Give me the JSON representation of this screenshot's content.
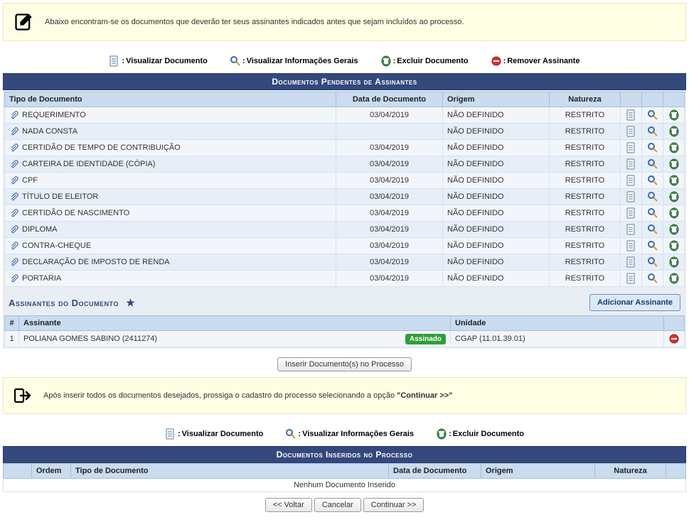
{
  "info1": "Abaixo encontram-se os documentos que deverão ter seus assinantes indicados antes que sejam incluídos ao processo.",
  "legend": {
    "view_doc": "Visualizar Documento",
    "view_info": "Visualizar Informações Gerais",
    "delete_doc": "Excluir Documento",
    "remove_signer": "Remover Assinante"
  },
  "section1_title": "Documentos Pendentes de Assinantes",
  "table1_headers": {
    "tipo": "Tipo de Documento",
    "data": "Data de Documento",
    "origem": "Origem",
    "natureza": "Natureza"
  },
  "docs": [
    {
      "tipo": "REQUERIMENTO",
      "data": "03/04/2019",
      "origem": "NÃO DEFINIDO",
      "natureza": "RESTRITO"
    },
    {
      "tipo": "NADA CONSTA",
      "data": "",
      "origem": "NÃO DEFINIDO",
      "natureza": "RESTRITO"
    },
    {
      "tipo": "CERTIDÃO DE TEMPO DE CONTRIBUIÇÃO",
      "data": "03/04/2019",
      "origem": "NÃO DEFINIDO",
      "natureza": "RESTRITO"
    },
    {
      "tipo": "CARTEIRA DE IDENTIDADE (CÓPIA)",
      "data": "03/04/2019",
      "origem": "NÃO DEFINIDO",
      "natureza": "RESTRITO"
    },
    {
      "tipo": "CPF",
      "data": "03/04/2019",
      "origem": "NÃO DEFINIDO",
      "natureza": "RESTRITO"
    },
    {
      "tipo": "TÍTULO DE ELEITOR",
      "data": "03/04/2019",
      "origem": "NÃO DEFINIDO",
      "natureza": "RESTRITO"
    },
    {
      "tipo": "CERTIDÃO DE NASCIMENTO",
      "data": "03/04/2019",
      "origem": "NÃO DEFINIDO",
      "natureza": "RESTRITO"
    },
    {
      "tipo": "DIPLOMA",
      "data": "03/04/2019",
      "origem": "NÃO DEFINIDO",
      "natureza": "RESTRITO"
    },
    {
      "tipo": "CONTRA-CHEQUE",
      "data": "03/04/2019",
      "origem": "NÃO DEFINIDO",
      "natureza": "RESTRITO"
    },
    {
      "tipo": "DECLARAÇÃO DE IMPOSTO DE RENDA",
      "data": "03/04/2019",
      "origem": "NÃO DEFINIDO",
      "natureza": "RESTRITO"
    },
    {
      "tipo": "PORTARIA",
      "data": "03/04/2019",
      "origem": "NÃO DEFINIDO",
      "natureza": "RESTRITO"
    }
  ],
  "signers_title": "Assinantes do Documento",
  "add_signer_label": "Adicionar Assinante",
  "signers_headers": {
    "num": "#",
    "assinante": "Assinante",
    "unidade": "Unidade"
  },
  "signers": [
    {
      "num": "1",
      "nome": "POLIANA GOMES SABINO (2411274)",
      "badge": "Assinado",
      "unidade": "CGAP (11.01.39.01)"
    }
  ],
  "insert_btn": "Inserir Documento(s) no Processo",
  "info2_prefix": "Após inserir todos os documentos desejados, prossiga o cadastro do processo selecionando a opção ",
  "info2_bold": "\"Continuar >>\"",
  "legend2": {
    "view_doc": "Visualizar Documento",
    "view_info": "Visualizar Informações Gerais",
    "delete_doc": "Excluir Documento"
  },
  "section2_title": "Documentos Inseridos no Processo",
  "table2_headers": {
    "ordem": "Ordem",
    "tipo": "Tipo de Documento",
    "data": "Data de Documento",
    "origem": "Origem",
    "natureza": "Natureza"
  },
  "empty_msg": "Nenhum Documento Inserido",
  "buttons": {
    "voltar": "<< Voltar",
    "cancelar": "Cancelar",
    "continuar": "Continuar >>"
  }
}
